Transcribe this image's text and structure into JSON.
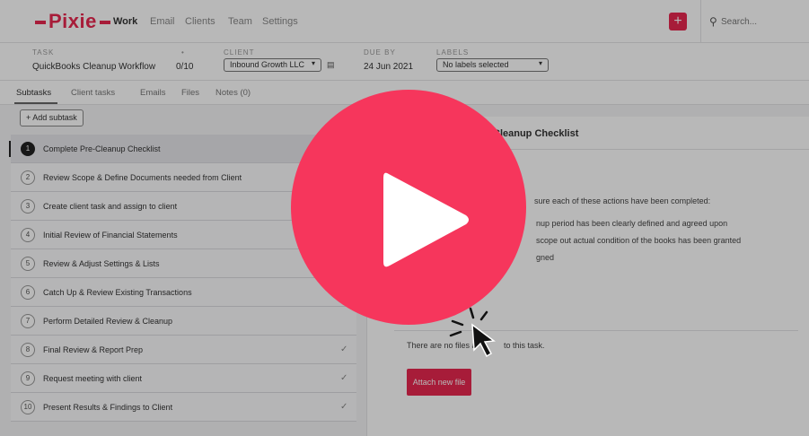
{
  "nav": {
    "logo": "Pixie",
    "items": [
      "Work",
      "Email",
      "Clients",
      "Team",
      "Settings"
    ],
    "search_placeholder": "Search..."
  },
  "task": {
    "task_label": "TASK",
    "task_name": "QuickBooks Cleanup Workflow",
    "progress": "0/10",
    "client_label": "CLIENT",
    "client_value": "Inbound Growth LLC",
    "due_label": "DUE BY",
    "due_value": "24 Jun 2021",
    "labels_label": "LABELS",
    "labels_value": "No labels selected"
  },
  "tabs": [
    "Subtasks",
    "Client tasks",
    "Emails",
    "Files",
    "Notes (0)"
  ],
  "add_subtask": "+ Add subtask",
  "subtasks": [
    {
      "num": "1",
      "label": "Complete Pre-Cleanup Checklist"
    },
    {
      "num": "2",
      "label": "Review Scope & Define Documents needed from Client"
    },
    {
      "num": "3",
      "label": "Create client task and assign to client"
    },
    {
      "num": "4",
      "label": "Initial Review of Financial Statements"
    },
    {
      "num": "5",
      "label": "Review & Adjust Settings & Lists"
    },
    {
      "num": "6",
      "label": "Catch Up & Review Existing Transactions"
    },
    {
      "num": "7",
      "label": "Perform Detailed Review & Cleanup"
    },
    {
      "num": "8",
      "label": "Final Review & Report Prep"
    },
    {
      "num": "9",
      "label": "Request meeting with client"
    },
    {
      "num": "10",
      "label": "Present Results & Findings to Client"
    }
  ],
  "panel": {
    "title": "Cleanup Checklist",
    "line1": "sure each of these actions have been completed:",
    "line2": "nup period has been clearly defined and agreed upon",
    "line3": "scope out actual condition of the books has been granted",
    "line4": "gned",
    "no_files": "There are no files a",
    "no_files_end": "to this task.",
    "attach": "Attach new file"
  },
  "colors": {
    "brand": "#e8284f",
    "play": "#f6365c"
  }
}
